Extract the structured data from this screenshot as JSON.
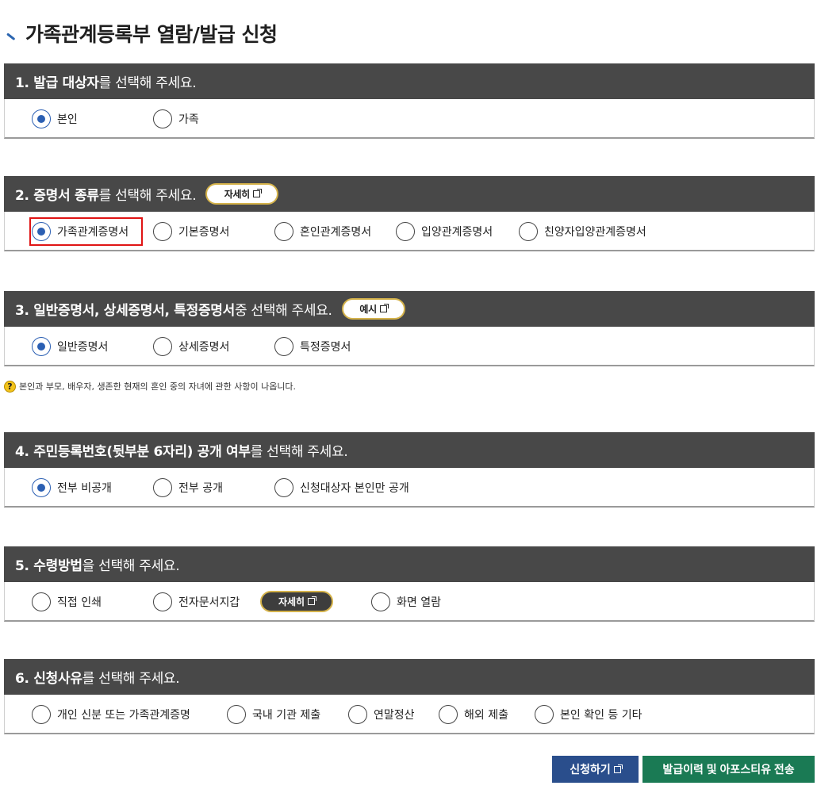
{
  "page": {
    "title": "가족관계등록부 열람/발급 신청"
  },
  "sections": [
    {
      "bold": "1. 발급 대상자",
      "rest": "를 선택해 주세요.",
      "options": [
        {
          "label": "본인",
          "selected": true
        },
        {
          "label": "가족",
          "selected": false
        }
      ]
    },
    {
      "bold": "2. 증명서 종류",
      "rest": "를 선택해 주세요.",
      "detail_button": "자세히",
      "options": [
        {
          "label": "가족관계증명서",
          "selected": true
        },
        {
          "label": "기본증명서",
          "selected": false
        },
        {
          "label": "혼인관계증명서",
          "selected": false
        },
        {
          "label": "입양관계증명서",
          "selected": false
        },
        {
          "label": "친양자입양관계증명서",
          "selected": false
        }
      ]
    },
    {
      "bold": "3. 일반증명서, 상세증명서, 특정증명서",
      "rest": " 중 선택해 주세요.",
      "detail_button": "예시",
      "options": [
        {
          "label": "일반증명서",
          "selected": true
        },
        {
          "label": "상세증명서",
          "selected": false
        },
        {
          "label": "특정증명서",
          "selected": false
        }
      ],
      "hint": "본인과 부모, 배우자, 생존한 현재의 혼인 중의 자녀에 관한 사항이 나옵니다."
    },
    {
      "bold": "4. 주민등록번호(뒷부분 6자리) 공개 여부",
      "rest": "를 선택해 주세요.",
      "options": [
        {
          "label": "전부 비공개",
          "selected": true
        },
        {
          "label": "전부 공개",
          "selected": false
        },
        {
          "label": "신청대상자 본인만 공개",
          "selected": false
        }
      ]
    },
    {
      "bold": "5. 수령방법",
      "rest": "을 선택해 주세요.",
      "detail_button": "자세히",
      "options": [
        {
          "label": "직접 인쇄",
          "selected": false
        },
        {
          "label": "전자문서지갑",
          "selected": false
        },
        {
          "label": "화면 열람",
          "selected": false
        }
      ]
    },
    {
      "bold": "6. 신청사유",
      "rest": "를 선택해 주세요.",
      "options": [
        {
          "label": "개인 신분 또는 가족관계증명",
          "selected": false
        },
        {
          "label": "국내 기관 제출",
          "selected": false
        },
        {
          "label": "연말정산",
          "selected": false
        },
        {
          "label": "해외 제출",
          "selected": false
        },
        {
          "label": "본인 확인 등 기타",
          "selected": false
        }
      ]
    }
  ],
  "buttons": {
    "apply": "신청하기",
    "history": "발급이력 및 아포스티유 전송"
  },
  "colors": {
    "header_bg": "#484848",
    "radio_selected": "#2b5fb3",
    "apply_button": "#2a4e8c",
    "history_button": "#1a7a54",
    "highlight": "#e01414"
  }
}
